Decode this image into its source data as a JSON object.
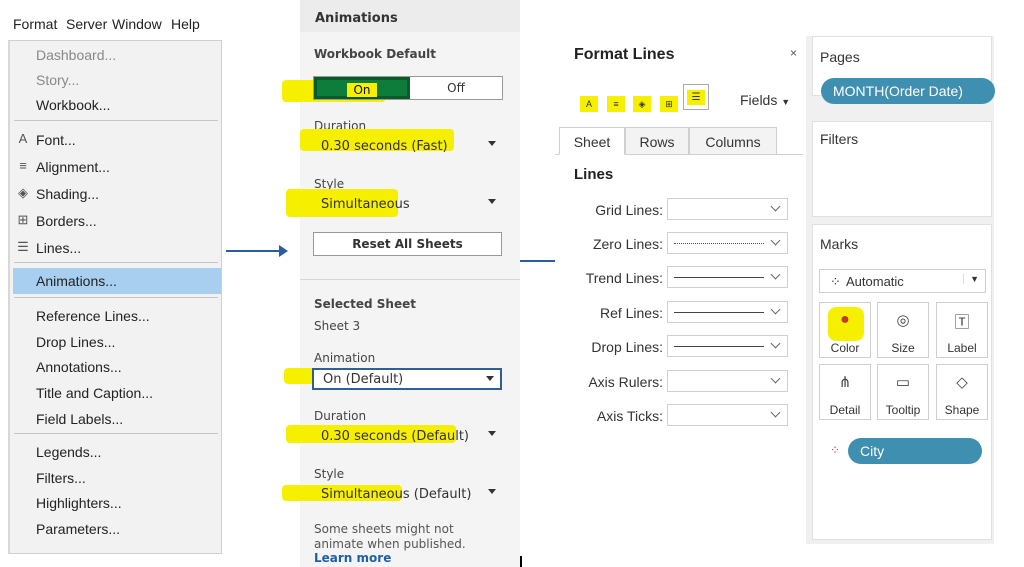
{
  "menubar": [
    "Format",
    "Server",
    "Window",
    "Help"
  ],
  "menu": {
    "items": [
      {
        "label": "Dashboard...",
        "icon": "",
        "disabled": true
      },
      {
        "label": "Story...",
        "icon": "",
        "disabled": true
      },
      {
        "label": "Workbook...",
        "icon": ""
      },
      {
        "label": "Font...",
        "icon": "font-icon"
      },
      {
        "label": "Alignment...",
        "icon": "alignment-icon"
      },
      {
        "label": "Shading...",
        "icon": "shading-icon"
      },
      {
        "label": "Borders...",
        "icon": "borders-icon"
      },
      {
        "label": "Lines...",
        "icon": "lines-icon"
      },
      {
        "label": "Animations...",
        "icon": "",
        "selected": true
      },
      {
        "label": "Reference Lines...",
        "icon": ""
      },
      {
        "label": "Drop Lines...",
        "icon": ""
      },
      {
        "label": "Annotations...",
        "icon": ""
      },
      {
        "label": "Title and Caption...",
        "icon": ""
      },
      {
        "label": "Field Labels...",
        "icon": ""
      },
      {
        "label": "Legends...",
        "icon": ""
      },
      {
        "label": "Filters...",
        "icon": ""
      },
      {
        "label": "Highlighters...",
        "icon": ""
      },
      {
        "label": "Parameters...",
        "icon": ""
      }
    ]
  },
  "animations": {
    "title": "Animations",
    "workbook_default": "Workbook Default",
    "toggle_on": "On",
    "toggle_off": "Off",
    "duration_label": "Duration",
    "duration_value": "0.30 seconds (Fast)",
    "style_label": "Style",
    "style_value": "Simultaneous",
    "reset_button": "Reset All Sheets",
    "selected_sheet": "Selected Sheet",
    "sheet_name": "Sheet 3",
    "animation_label": "Animation",
    "animation_value": "On (Default)",
    "sheet_duration_label": "Duration",
    "sheet_duration_value": "0.30 seconds (Default)",
    "sheet_style_label": "Style",
    "sheet_style_value": "Simultaneous (Default)",
    "note": "Some sheets might not animate when published.",
    "learn_more": "Learn more"
  },
  "format_lines": {
    "title": "Format Lines",
    "close": "×",
    "fields_label": "Fields",
    "tabs": [
      "Sheet",
      "Rows",
      "Columns"
    ],
    "section": "Lines",
    "rows": [
      {
        "label": "Grid Lines:",
        "line": "none"
      },
      {
        "label": "Zero Lines:",
        "line": "dotted"
      },
      {
        "label": "Trend Lines:",
        "line": "solid"
      },
      {
        "label": "Ref Lines:",
        "line": "solid"
      },
      {
        "label": "Drop Lines:",
        "line": "solid"
      },
      {
        "label": "Axis Rulers:",
        "line": "none"
      },
      {
        "label": "Axis Ticks:",
        "line": "none"
      }
    ]
  },
  "shelves": {
    "pages": "Pages",
    "pages_pill": "MONTH(Order Date)",
    "filters": "Filters",
    "marks": "Marks",
    "mark_type": "Automatic",
    "buttons": [
      {
        "label": "Color",
        "icon": "color-icon"
      },
      {
        "label": "Size",
        "icon": "size-icon"
      },
      {
        "label": "Label",
        "icon": "label-icon"
      },
      {
        "label": "Detail",
        "icon": "detail-icon"
      },
      {
        "label": "Tooltip",
        "icon": "tooltip-icon"
      },
      {
        "label": "Shape",
        "icon": "shape-icon"
      }
    ],
    "color_pill": "City"
  },
  "colors": {
    "highlight": "#f6f000",
    "selection": "#a8cff0",
    "toggle_on": "#0e7c3a",
    "pill": "#3e8fb0",
    "arrow": "#2b5d9e",
    "link": "#1f5fa6"
  }
}
